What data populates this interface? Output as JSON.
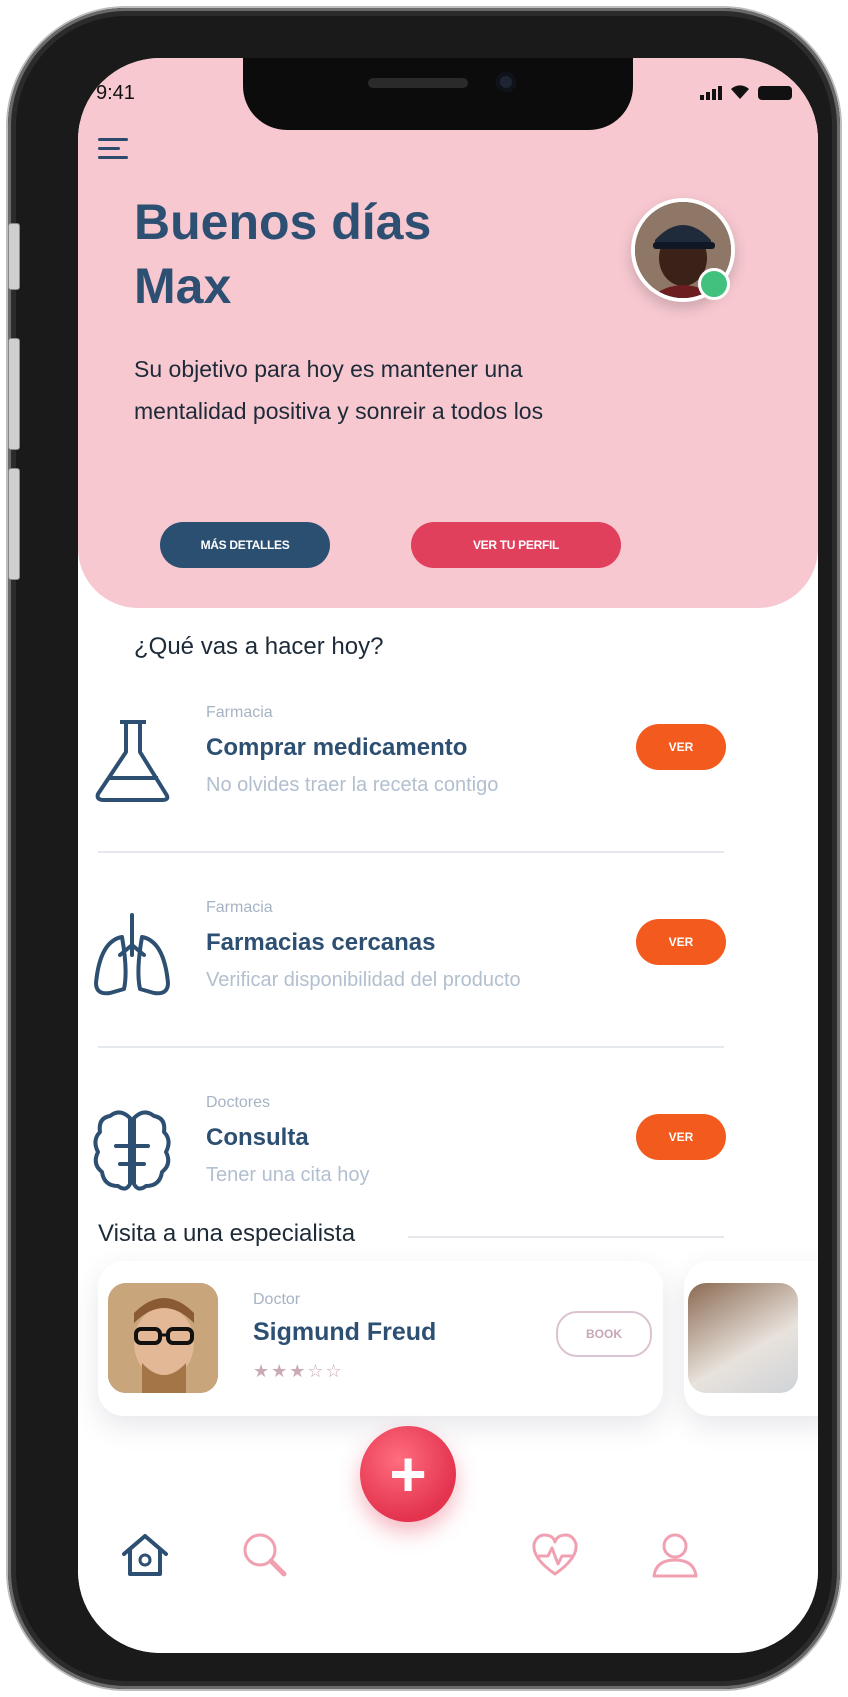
{
  "status_bar": {
    "time": "9:41"
  },
  "header": {
    "greeting_line1": "Buenos días",
    "greeting_line2": "Max",
    "subtitle_line1": "Su objetivo para hoy es mantener una",
    "subtitle_line2": "mentalidad positiva y sonreir a todos los",
    "details_button": "MÁS DETALLES",
    "profile_button": "VER TU PERFIL"
  },
  "tasks_section": {
    "title": "¿Qué vas a hacer hoy?",
    "items": [
      {
        "category": "Farmacia",
        "title": "Comprar medicamento",
        "description": "No olvides traer la receta contigo",
        "button": "VER",
        "icon": "flask-icon"
      },
      {
        "category": "Farmacia",
        "title": "Farmacias cercanas",
        "description": "Verificar disponibilidad del producto",
        "button": "VER",
        "icon": "lungs-icon"
      },
      {
        "category": "Doctores",
        "title": "Consulta",
        "description": "Tener una cita hoy",
        "button": "VER",
        "icon": "brain-icon"
      }
    ]
  },
  "specialists_section": {
    "title": "Visita a una especialista",
    "doctor": {
      "role": "Doctor",
      "name": "Sigmund Freud",
      "rating": 3,
      "rating_max": 5,
      "stars": "★★★☆☆",
      "button": "BOOK"
    }
  },
  "bottom_nav": {
    "items": [
      "home-icon",
      "search-icon",
      "heart-icon",
      "profile-icon"
    ],
    "fab": "+"
  },
  "colors": {
    "header_bg": "#f7c8d0",
    "navy": "#2d4f72",
    "accent_red": "#e0405c",
    "accent_orange": "#f25a1e",
    "online_green": "#41c17d"
  }
}
